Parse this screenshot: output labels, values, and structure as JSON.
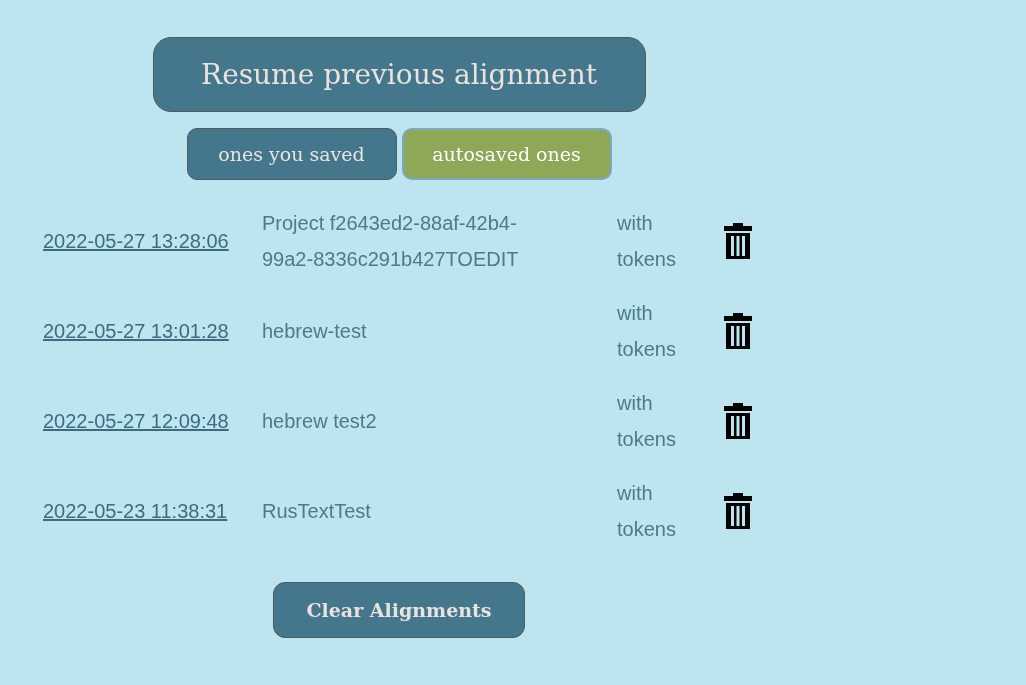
{
  "resume_button": "Resume previous alignment",
  "tabs": [
    {
      "label": "ones you saved",
      "selected": false
    },
    {
      "label": "autosaved ones",
      "selected": true
    }
  ],
  "alignments": [
    {
      "date": "2022-05-27 13:28:06",
      "name": "Project f2643ed2-88af-42b4-99a2-8336c291b427TOEDIT",
      "mode": "with tokens"
    },
    {
      "date": "2022-05-27 13:01:28",
      "name": "hebrew-test",
      "mode": "with tokens"
    },
    {
      "date": "2022-05-27 12:09:48",
      "name": "hebrew test2",
      "mode": "with tokens"
    },
    {
      "date": "2022-05-23 11:38:31",
      "name": "RusTextTest",
      "mode": "with tokens"
    }
  ],
  "clear_button": "Clear Alignments"
}
